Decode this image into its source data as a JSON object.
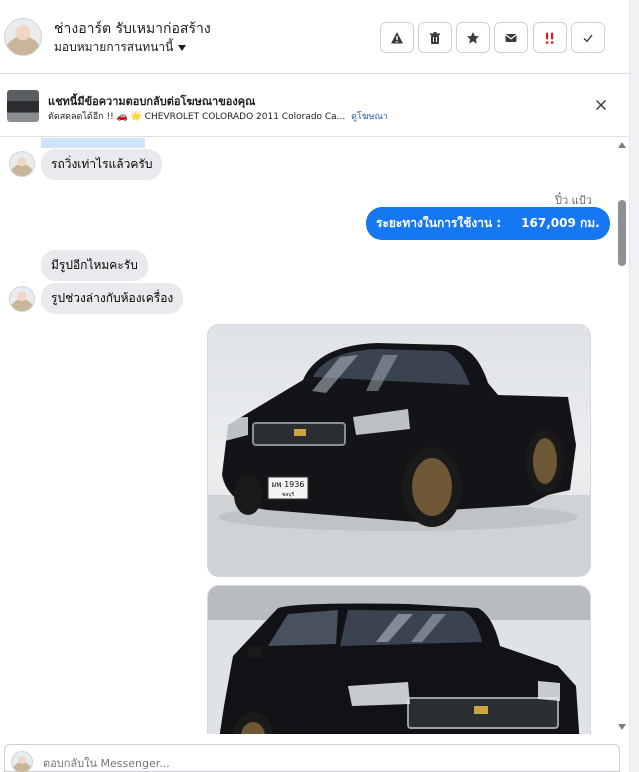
{
  "header": {
    "page_name": "ช่างอาร์ต รับเหมาก่อสร้าง",
    "assign_label": "มอบหมายการสนทนานี้",
    "actions": [
      {
        "icon": "warning-icon"
      },
      {
        "icon": "trash-icon"
      },
      {
        "icon": "star-icon"
      },
      {
        "icon": "mail-icon"
      },
      {
        "icon": "spam-icon"
      },
      {
        "icon": "checkmark-icon"
      }
    ]
  },
  "ad_banner": {
    "title": "แชทนี้มีข้อความตอบกลับต่อโฆษณาของคุณ",
    "subtitle": "ตัดสดลดได้อีก !! 🚗 🌟 CHEVROLET COLORADO 2011 Colorado Ca...",
    "link": "ดูโฆษณา"
  },
  "messages": [
    {
      "direction": "in",
      "text": "รถวิ่งเท่าไรแล้วครับ"
    },
    {
      "direction": "out",
      "sender": "ปิ๋ว แป้ว",
      "text_label": "ระยะทางในการใช้งาน :",
      "text_value": "167,009 กม."
    },
    {
      "direction": "in",
      "text": "มีรูปอีกไหมคะรับ"
    },
    {
      "direction": "in",
      "text": "รูปช่วงล่างกับห้องเครื่อง"
    },
    {
      "direction": "out",
      "type": "image",
      "plate_line1": "ผพ 1936",
      "plate_line2": "ชลบุรี"
    },
    {
      "direction": "out",
      "type": "image"
    }
  ],
  "composer": {
    "placeholder": "ตอบกลับใน Messenger..."
  },
  "colors": {
    "outgoing_bubble": "#1677f2",
    "incoming_bubble": "#e9eaed",
    "link": "#1a5fb4"
  }
}
